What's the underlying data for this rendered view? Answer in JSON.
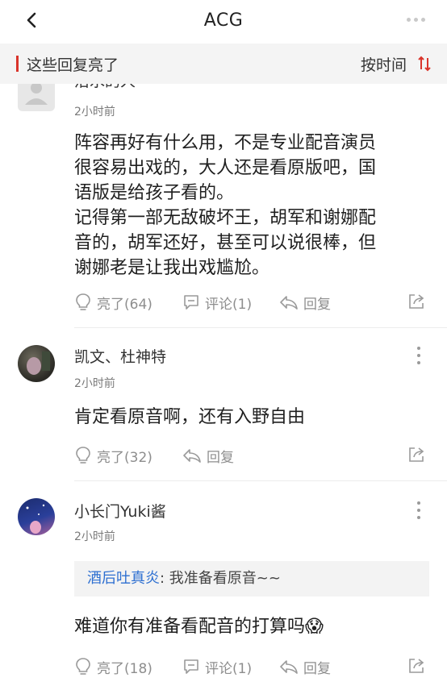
{
  "nav": {
    "title": "ACG"
  },
  "section": {
    "label": "这些回复亮了",
    "sort_label": "按时间"
  },
  "comments": [
    {
      "username": "沿水的人",
      "time": "2小时前",
      "lines": [
        "阵容再好有什么用，不是专业配音演员",
        "很容易出戏的，大人还是看原版吧，国",
        "语版是给孩子看的。",
        "记得第一部无敌破坏王，胡军和谢娜配",
        "音的，胡军还好，甚至可以说很棒，但",
        "谢娜老是让我出戏尴尬。"
      ],
      "like_label": "亮了(64)",
      "comment_label": "评论(1)",
      "reply_label": "回复"
    },
    {
      "username": "凯文、杜神特",
      "time": "2小时前",
      "lines": [
        "肯定看原音啊，还有入野自由"
      ],
      "like_label": "亮了(32)",
      "reply_label": "回复"
    },
    {
      "username": "小长门Yuki酱",
      "time": "2小时前",
      "quote_user": "酒后吐真炎",
      "quote_text": ": 我准备看原音~~",
      "lines": [
        "难道你有准备看配音的打算吗😱"
      ],
      "like_label": "亮了(18)",
      "comment_label": "评论(1)",
      "reply_label": "回复"
    }
  ],
  "colors": {
    "accent": "#d9342b",
    "link": "#2d6fd1",
    "muted": "#8e8e8e"
  },
  "icons": [
    "back-arrow-icon",
    "more-dots-icon",
    "sort-arrows-icon",
    "lightbulb-icon",
    "comment-bubble-icon",
    "reply-arrow-icon",
    "share-icon",
    "kebab-menu-icon"
  ]
}
